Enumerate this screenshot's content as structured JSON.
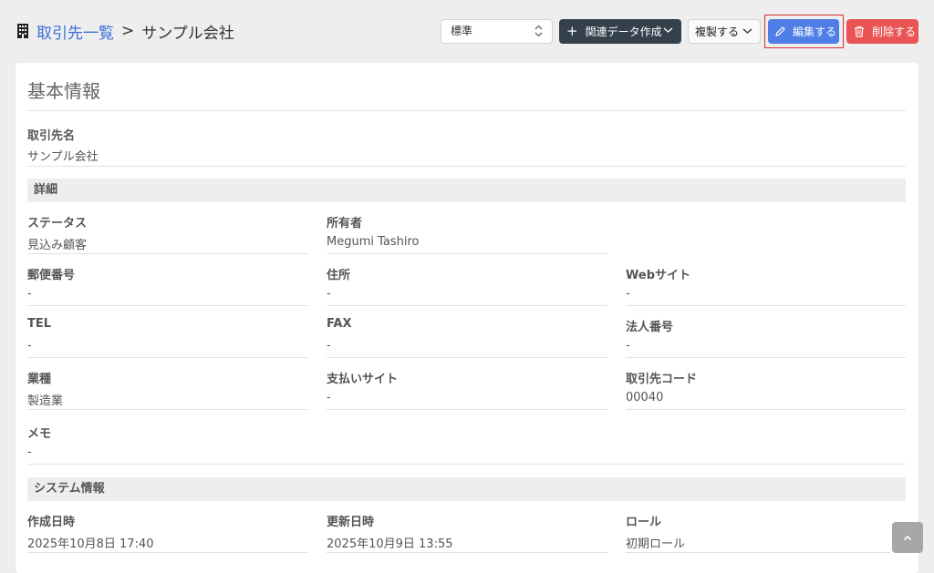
{
  "header": {
    "breadcrumb_link": "取引先一覧",
    "breadcrumb_sep": ">",
    "breadcrumb_current": "サンプル会社",
    "layout_select": "標準",
    "related_button": "関連データ作成",
    "copy_button": "複製する",
    "edit_button": "編集する",
    "delete_button": "削除する"
  },
  "card": {
    "title": "基本情報",
    "name_label": "取引先名",
    "name_value": "サンプル会社"
  },
  "details": {
    "section": "詳細",
    "fields": [
      {
        "label": "ステータス",
        "value": "見込み顧客"
      },
      {
        "label": "所有者",
        "value": "Megumi Tashiro"
      },
      {
        "label": "郵便番号",
        "value": "-"
      },
      {
        "label": "住所",
        "value": "-"
      },
      {
        "label": "Webサイト",
        "value": "-"
      },
      {
        "label": "TEL",
        "value": "-"
      },
      {
        "label": "FAX",
        "value": "-"
      },
      {
        "label": "法人番号",
        "value": "-"
      },
      {
        "label": "業種",
        "value": "製造業"
      },
      {
        "label": "支払いサイト",
        "value": "-"
      },
      {
        "label": "取引先コード",
        "value": "00040"
      },
      {
        "label": "メモ",
        "value": "-"
      }
    ]
  },
  "system": {
    "section": "システム情報",
    "fields": [
      {
        "label": "作成日時",
        "value": "2025年10月8日 17:40"
      },
      {
        "label": "更新日時",
        "value": "2025年10月9日 13:55"
      },
      {
        "label": "ロール",
        "value": "初期ロール"
      }
    ]
  },
  "colors": {
    "link": "#3d6ed6",
    "edit": "#4f7ee6",
    "delete": "#ea5455",
    "dark_button": "#34404b",
    "highlight": "#d8302f"
  },
  "icons": [
    "building-icon",
    "updown-icon",
    "plus-icon",
    "chevron-down-icon",
    "pencil-icon",
    "trash-icon",
    "arrow-up-icon"
  ]
}
